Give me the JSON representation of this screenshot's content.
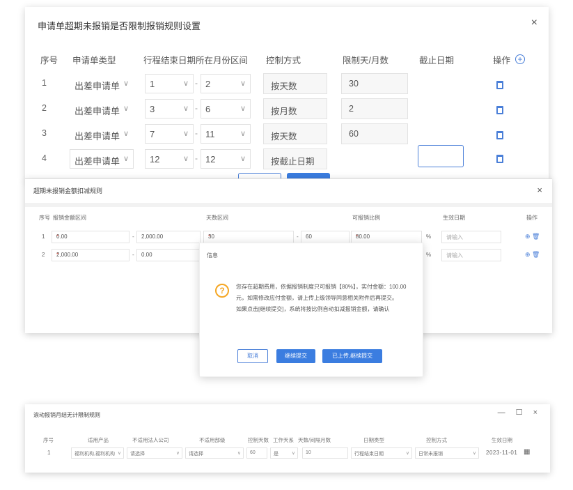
{
  "dialog1": {
    "title": "申请单超期未报销是否限制报销规则设置",
    "close": "×",
    "headers": {
      "index": "序号",
      "type": "申请单类型",
      "range": "行程结束日期所在月份区间",
      "control": "控制方式",
      "limit": "限制天/月数",
      "deadline": "截止日期",
      "action": "操作"
    },
    "add_icon": "+",
    "rows": [
      {
        "index": "1",
        "type": "出差申请单",
        "from": "1",
        "to": "2",
        "control": "按天数",
        "limit": "30",
        "deadline": ""
      },
      {
        "index": "2",
        "type": "出差申请单",
        "from": "3",
        "to": "6",
        "control": "按月数",
        "limit": "2",
        "deadline": ""
      },
      {
        "index": "3",
        "type": "出差申请单",
        "from": "7",
        "to": "11",
        "control": "按天数",
        "limit": "60",
        "deadline": ""
      },
      {
        "index": "4",
        "type": "出差申请单",
        "from": "12",
        "to": "12",
        "control": "按截止日期",
        "limit": "",
        "deadline": ""
      }
    ],
    "dash": "-",
    "chevron": "∨"
  },
  "dialog2": {
    "title": "超期未报销金额扣减规则",
    "close": "×",
    "headers": {
      "index": "序号",
      "amount": "报销金额区间",
      "days": "天数区间",
      "ratio": "可报销比例",
      "effective": "生效日期",
      "action": "操作"
    },
    "action_icons": "⊕ 🗑",
    "rows": [
      {
        "index": "1",
        "amt_from": "0.00",
        "amt_to": "2,000.00",
        "day_from": "30",
        "day_to": "60",
        "ratio": "80.00",
        "unit": "%",
        "date_placeholder": "请输入"
      },
      {
        "index": "2",
        "amt_from": "2,000.00",
        "amt_to": "0.00",
        "unit": "%",
        "date_placeholder": "请输入"
      }
    ],
    "dash": "-",
    "required": "*"
  },
  "confirm": {
    "header": "信息",
    "icon": "?",
    "message": "您存在超期费用，依据报销制度只可报销【80%】，实付金额：100.00元，如需修改应付金额，请上传上级领导同意相关附件后再提交。",
    "message2": "如果点击[继续提交]，系统将按比例自动扣减报销金额，请确认",
    "buttons": {
      "cancel": "取消",
      "continue": "继续提交",
      "uploaded": "已上传,继续提交"
    }
  },
  "dialog3": {
    "title": "滚动报销月结无计限制规则",
    "window_buttons": "— ☐ ×",
    "headers": {
      "index": "序号",
      "product": "适用产品",
      "company": "不适用法人公司",
      "dept": "不适用部级",
      "days": "控制天数",
      "work": "工作天系",
      "interval": "天数/间隔月数",
      "datetype": "日期类型",
      "control": "控制方式",
      "effective": "生效日期"
    },
    "row": {
      "index": "1",
      "product": "福利机构,福利机构",
      "company": "请选择",
      "dept": "请选择",
      "days": "60",
      "work": "是",
      "interval": "10",
      "datetype": "行程结束日期",
      "control": "日常未报销",
      "date": "2023-11-01"
    },
    "chevron": "∨",
    "calendar_icon": "▦"
  }
}
